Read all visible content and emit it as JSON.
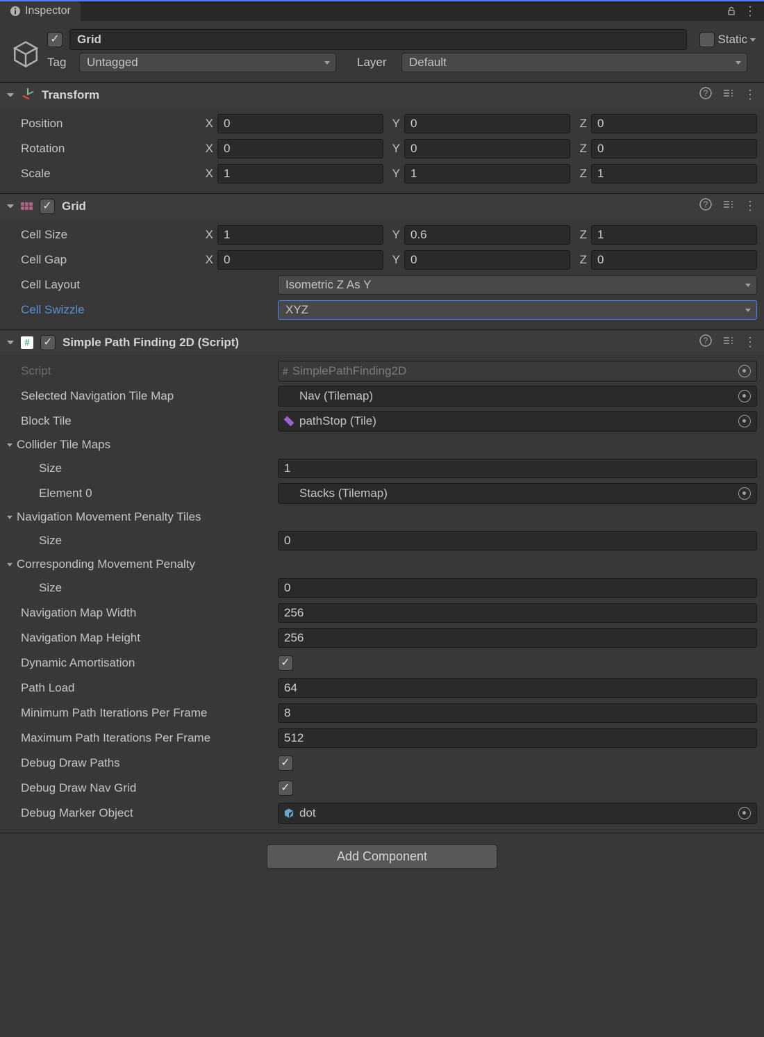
{
  "tab": {
    "title": "Inspector"
  },
  "header": {
    "name": "Grid",
    "active": true,
    "static_label": "Static",
    "static_checked": false,
    "tag_label": "Tag",
    "tag_value": "Untagged",
    "layer_label": "Layer",
    "layer_value": "Default"
  },
  "transform": {
    "title": "Transform",
    "position_label": "Position",
    "position": {
      "x": "0",
      "y": "0",
      "z": "0"
    },
    "rotation_label": "Rotation",
    "rotation": {
      "x": "0",
      "y": "0",
      "z": "0"
    },
    "scale_label": "Scale",
    "scale": {
      "x": "1",
      "y": "1",
      "z": "1"
    }
  },
  "grid": {
    "title": "Grid",
    "enabled": true,
    "cell_size_label": "Cell Size",
    "cell_size": {
      "x": "1",
      "y": "0.6",
      "z": "1"
    },
    "cell_gap_label": "Cell Gap",
    "cell_gap": {
      "x": "0",
      "y": "0",
      "z": "0"
    },
    "cell_layout_label": "Cell Layout",
    "cell_layout_value": "Isometric Z As Y",
    "cell_swizzle_label": "Cell Swizzle",
    "cell_swizzle_value": "XYZ"
  },
  "spf": {
    "title": "Simple Path Finding 2D (Script)",
    "enabled": true,
    "script_label": "Script",
    "script_value": "SimplePathFinding2D",
    "nav_tilemap_label": "Selected Navigation Tile Map",
    "nav_tilemap_value": "Nav (Tilemap)",
    "block_tile_label": "Block Tile",
    "block_tile_value": "pathStop (Tile)",
    "collider_maps_label": "Collider Tile Maps",
    "collider_size_label": "Size",
    "collider_size": "1",
    "collider_el0_label": "Element 0",
    "collider_el0_value": "Stacks (Tilemap)",
    "nav_penalty_tiles_label": "Navigation Movement Penalty Tiles",
    "nav_penalty_tiles_size": "0",
    "corr_penalty_label": "Corresponding Movement Penalty",
    "corr_penalty_size": "0",
    "nav_width_label": "Navigation Map Width",
    "nav_width": "256",
    "nav_height_label": "Navigation Map Height",
    "nav_height": "256",
    "dyn_amort_label": "Dynamic Amortisation",
    "dyn_amort": true,
    "path_load_label": "Path Load",
    "path_load": "64",
    "min_iter_label": "Minimum Path Iterations Per Frame",
    "min_iter": "8",
    "max_iter_label": "Maximum Path Iterations Per Frame",
    "max_iter": "512",
    "debug_paths_label": "Debug Draw Paths",
    "debug_paths": true,
    "debug_nav_label": "Debug Draw Nav Grid",
    "debug_nav": true,
    "debug_marker_label": "Debug Marker Object",
    "debug_marker_value": "dot"
  },
  "footer": {
    "add_component": "Add Component"
  },
  "axes": {
    "x": "X",
    "y": "Y",
    "z": "Z"
  },
  "size_label": "Size"
}
